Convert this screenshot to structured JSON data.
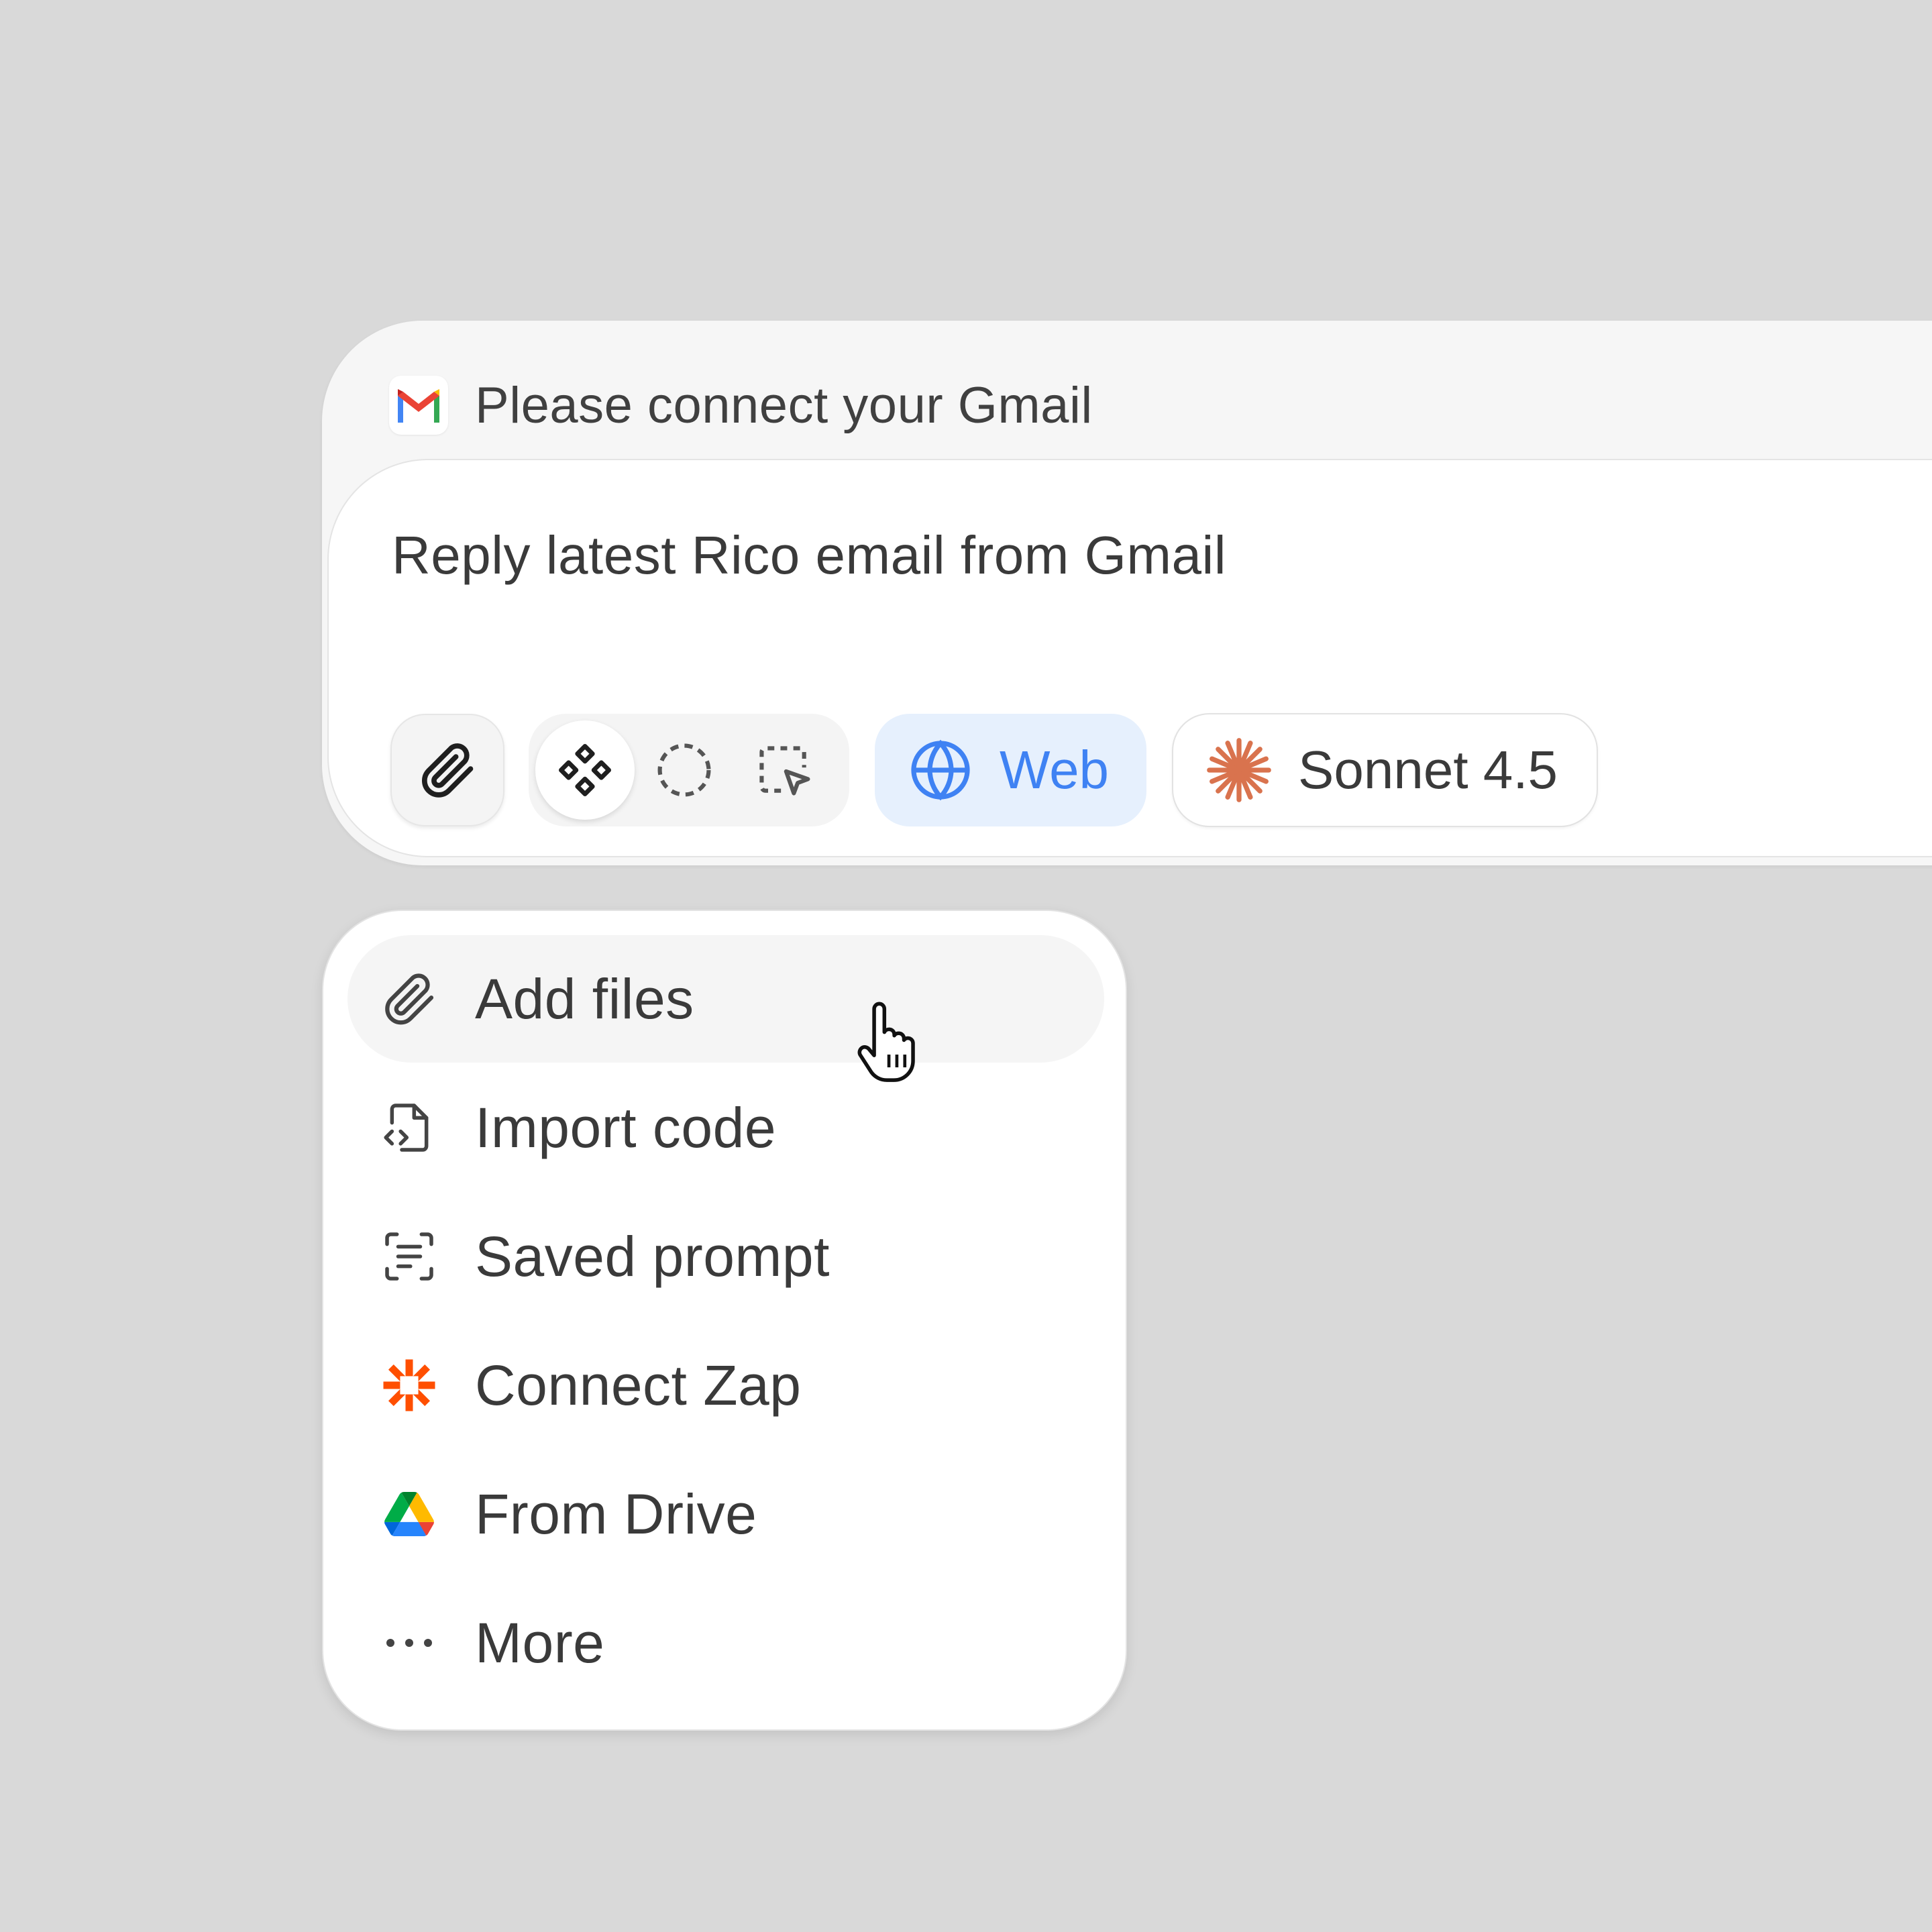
{
  "composer": {
    "notice": {
      "icon": "gmail-logo-icon",
      "text": "Please connect your Gmail"
    },
    "prompt": "Reply latest Rico email from Gmail",
    "toolbar": {
      "attach_icon": "paperclip-icon",
      "modes": [
        {
          "icon": "components-icon",
          "active": true
        },
        {
          "icon": "dashed-circle-icon",
          "active": false
        },
        {
          "icon": "select-region-icon",
          "active": false
        }
      ],
      "web": {
        "icon": "globe-icon",
        "label": "Web",
        "color": "#3f82f3",
        "active": true
      },
      "model": {
        "icon": "sparkle-asterisk-icon",
        "label": "Sonnet 4.5",
        "icon_color": "#d9734e"
      }
    }
  },
  "menu": {
    "items": [
      {
        "icon": "paperclip-icon",
        "label": "Add files",
        "hovered": true
      },
      {
        "icon": "code-file-icon",
        "label": "Import code"
      },
      {
        "icon": "saved-prompt-icon",
        "label": "Saved prompt"
      },
      {
        "icon": "zapier-icon",
        "label": "Connect Zap",
        "icon_color": "#ff4f00"
      },
      {
        "icon": "google-drive-icon",
        "label": "From Drive"
      },
      {
        "icon": "more-dots-icon",
        "label": "More"
      }
    ]
  },
  "cursor": {
    "icon": "hand-pointer-icon"
  }
}
